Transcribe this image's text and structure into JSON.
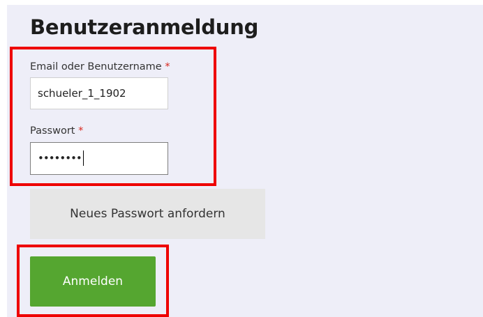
{
  "page": {
    "title": "Benutzeranmeldung"
  },
  "form": {
    "username": {
      "label": "Email oder Benutzername",
      "required_marker": "*",
      "value": "schueler_1_1902"
    },
    "password": {
      "label": "Passwort",
      "required_marker": "*",
      "masked_value": "••••••••"
    },
    "reset_button_label": "Neues Passwort anfordern",
    "submit_button_label": "Anmelden"
  },
  "colors": {
    "panel_background": "#eeeef8",
    "submit_button": "#55a630",
    "reset_button": "#e6e6e6",
    "required_marker": "#d9261c",
    "highlight_annotation": "#ee0000"
  }
}
